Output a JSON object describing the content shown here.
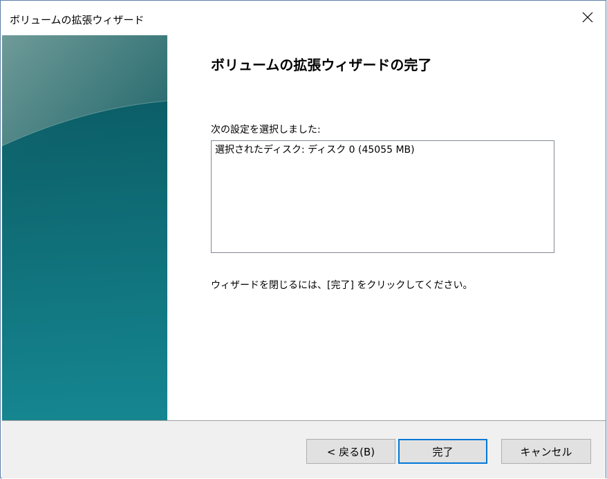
{
  "window": {
    "title": "ボリュームの拡張ウィザード"
  },
  "content": {
    "heading": "ボリュームの拡張ウィザードの完了",
    "selected_label": "次の設定を選択しました:",
    "settings": [
      "選択されたディスク: ディスク 0 (45055 MB)"
    ],
    "close_instruction": "ウィザードを閉じるには、[完了] をクリックしてください。"
  },
  "buttons": {
    "back": "< 戻る(B)",
    "finish": "完了",
    "cancel": "キャンセル"
  },
  "colors": {
    "side_panel_dark": "#0d5a63",
    "side_panel_light": "#5d8e8f",
    "default_button_border": "#0078d7"
  },
  "icons": {
    "close": "close-icon"
  }
}
